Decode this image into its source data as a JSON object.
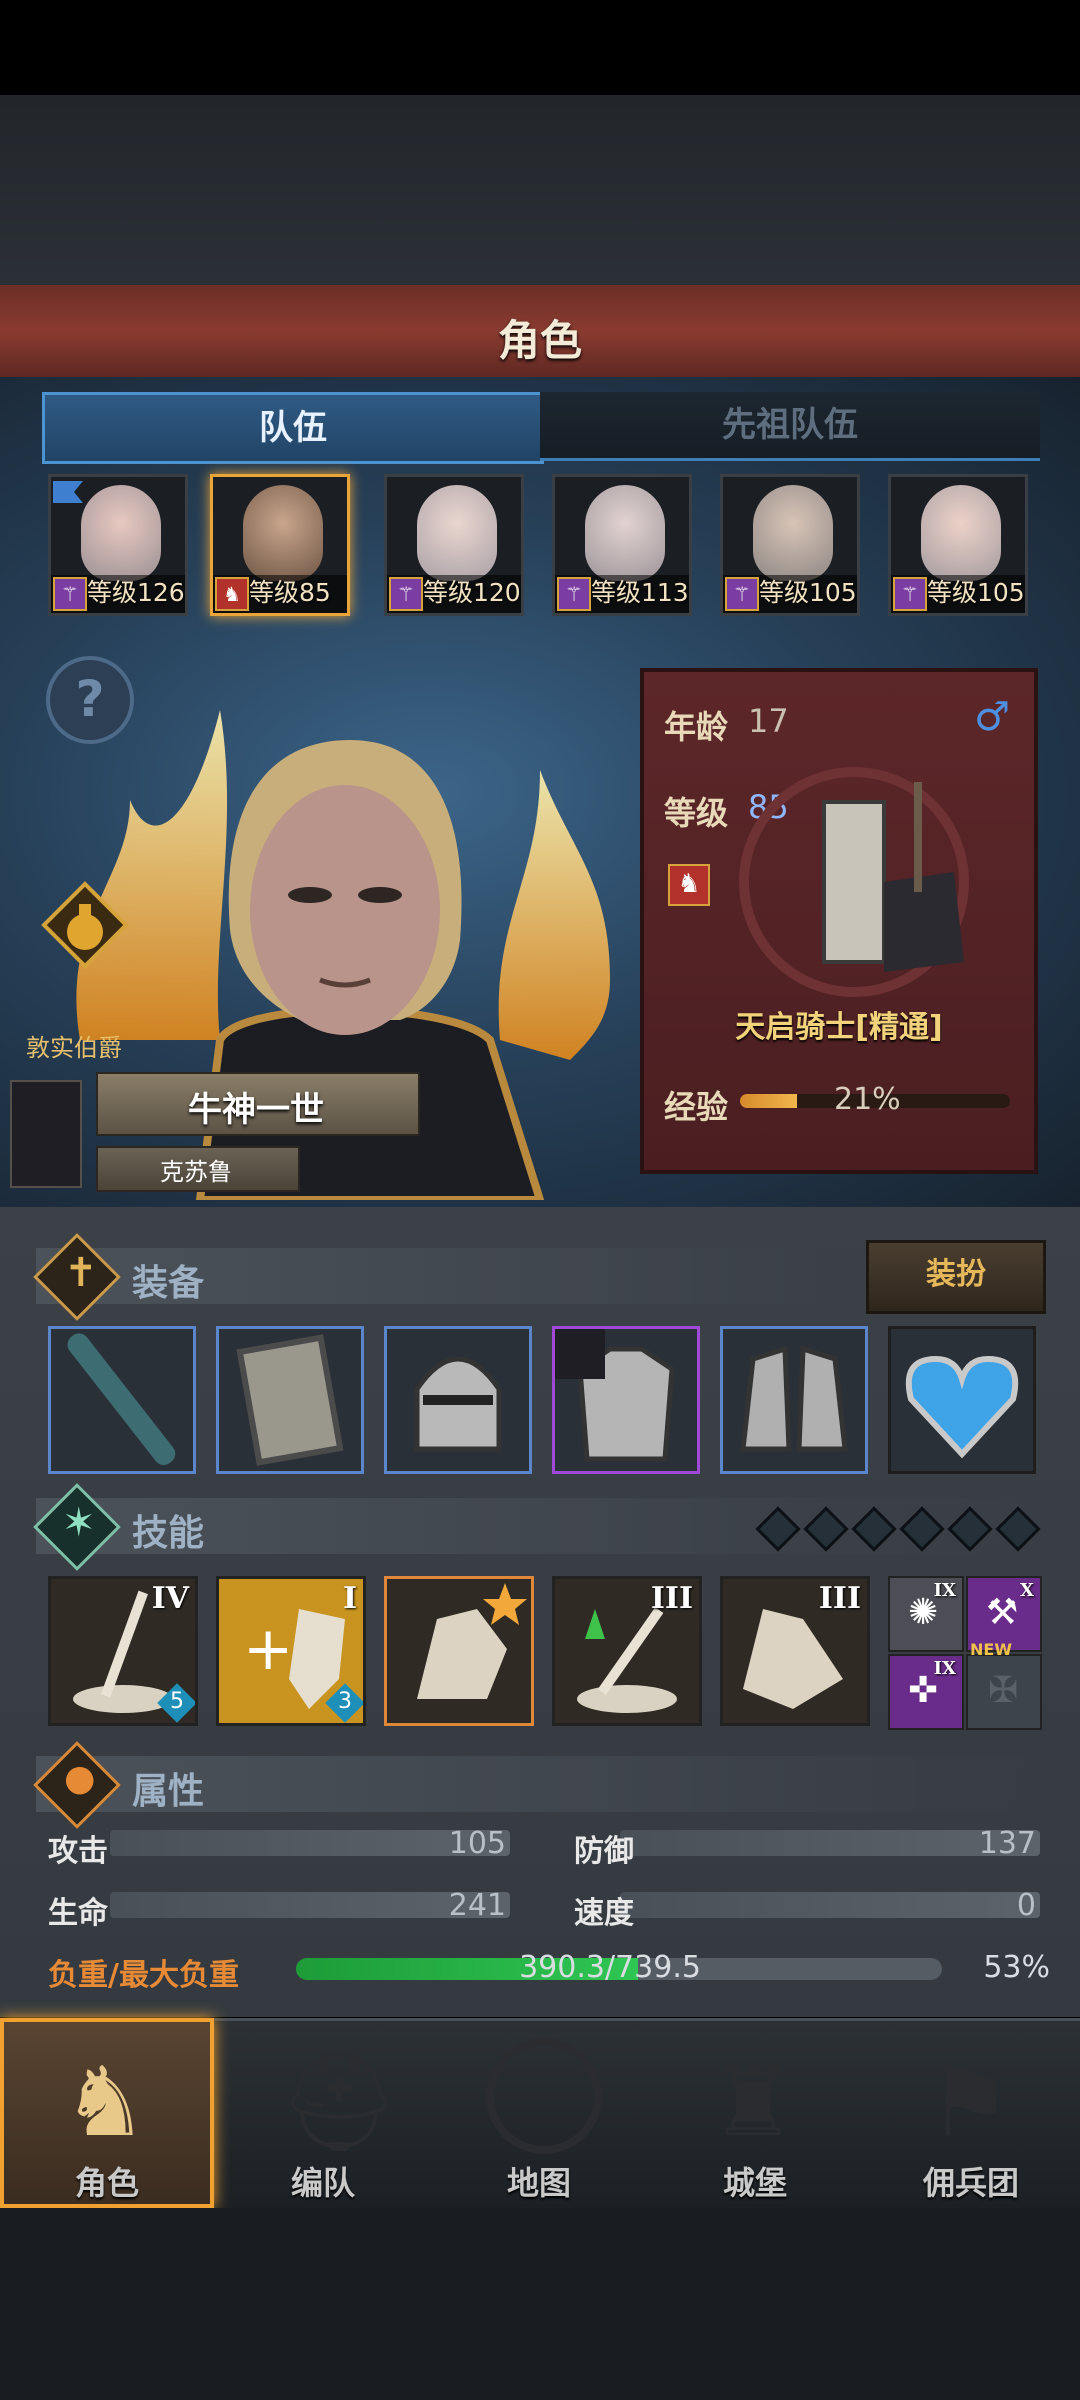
{
  "header": {
    "title": "角色"
  },
  "tabs": [
    {
      "label": "队伍"
    },
    {
      "label": "先祖队伍"
    }
  ],
  "roster": [
    {
      "level_text": "等级126",
      "class_icon": "wand-icon"
    },
    {
      "level_text": "等级85",
      "class_icon": "horse-icon"
    },
    {
      "level_text": "等级120",
      "class_icon": "wand-icon"
    },
    {
      "level_text": "等级113",
      "class_icon": "wand-icon"
    },
    {
      "level_text": "等级105",
      "class_icon": "wand-icon"
    },
    {
      "level_text": "等级105",
      "class_icon": "wand-icon"
    }
  ],
  "hero": {
    "title": "敦实伯爵",
    "name": "牛神一世",
    "guild": "克苏鲁",
    "age_label": "年龄",
    "age": "17",
    "level_label": "等级",
    "level": "85",
    "gender_symbol": "♂",
    "class_name": "天启骑士[精通]",
    "exp_label": "经验",
    "exp_text": "21%",
    "exp_fraction": 0.21
  },
  "equipment": {
    "title": "装备",
    "dress_button": "装扮",
    "slots": [
      "staff",
      "shield",
      "helmet",
      "armor",
      "boots",
      "amulet"
    ]
  },
  "skills": {
    "title": "技能",
    "items": [
      {
        "rank": "IV",
        "badge": "5"
      },
      {
        "rank": "I",
        "badge": "3"
      },
      {
        "rank": ""
      },
      {
        "rank": "III"
      },
      {
        "rank": "III"
      }
    ],
    "small": [
      {
        "rank": "IX"
      },
      {
        "rank": "X"
      },
      {
        "rank": "IX"
      },
      {
        "rank": ""
      }
    ],
    "new_label": "NEW"
  },
  "attributes": {
    "title": "属性",
    "attack_label": "攻击",
    "attack": "105",
    "defense_label": "防御",
    "defense": "137",
    "hp_label": "生命",
    "hp": "241",
    "speed_label": "速度",
    "speed": "0",
    "weight_label": "负重/最大负重",
    "weight_text": "390.3/739.5",
    "weight_percent": "53%",
    "weight_fraction": 0.53
  },
  "nav": [
    {
      "label": "角色"
    },
    {
      "label": "编队"
    },
    {
      "label": "地图"
    },
    {
      "label": "城堡"
    },
    {
      "label": "佣兵团"
    }
  ],
  "colors": {
    "accent": "#f0a130",
    "header": "#7a3329",
    "tab_active": "#4b93d1",
    "exp": "#f1b64c",
    "weight": "#2fc653"
  }
}
